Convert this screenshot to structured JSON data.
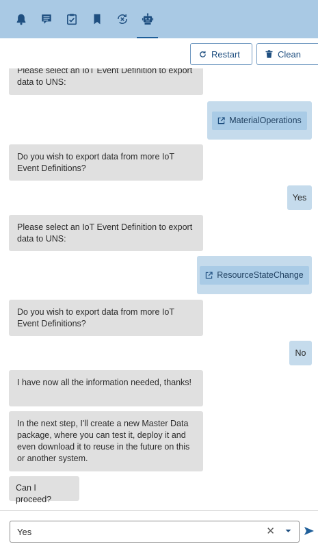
{
  "toolbar": {
    "tabs": [
      {
        "icon": "bell-icon"
      },
      {
        "icon": "chat-icon"
      },
      {
        "icon": "clipboard-check-icon"
      },
      {
        "icon": "bookmark-icon"
      },
      {
        "icon": "sync-error-icon"
      },
      {
        "icon": "robot-icon",
        "active": true
      }
    ],
    "restart_label": "Restart",
    "clean_label": "Clean"
  },
  "chat": {
    "messages": [
      {
        "from": "bot",
        "text": "Please select an IoT Event Definition to export data to UNS:"
      },
      {
        "from": "user",
        "type": "link",
        "text": "MaterialOperations"
      },
      {
        "from": "bot",
        "text": "Do you wish to export data from more IoT Event Definitions?"
      },
      {
        "from": "user",
        "text": "Yes"
      },
      {
        "from": "bot",
        "text": "Please select an IoT Event Definition to export data to UNS:"
      },
      {
        "from": "user",
        "type": "link",
        "text": "ResourceStateChange"
      },
      {
        "from": "bot",
        "text": "Do you wish to export data from more IoT Event Definitions?"
      },
      {
        "from": "user",
        "text": "No"
      },
      {
        "from": "bot",
        "text": "I have now all the information needed, thanks!"
      },
      {
        "from": "bot",
        "text": "In the next step, I'll create a new Master Data package, where you can test it, deploy it and even download it to reuse in the future on this or another system."
      },
      {
        "from": "bot",
        "text": "Can I proceed?"
      }
    ]
  },
  "composer": {
    "value": "Yes"
  },
  "colors": {
    "topbar": "#a9c9e4",
    "bot_bubble": "#e0e0e0",
    "user_bubble": "#c5dbec",
    "accent": "#1f4f80"
  }
}
